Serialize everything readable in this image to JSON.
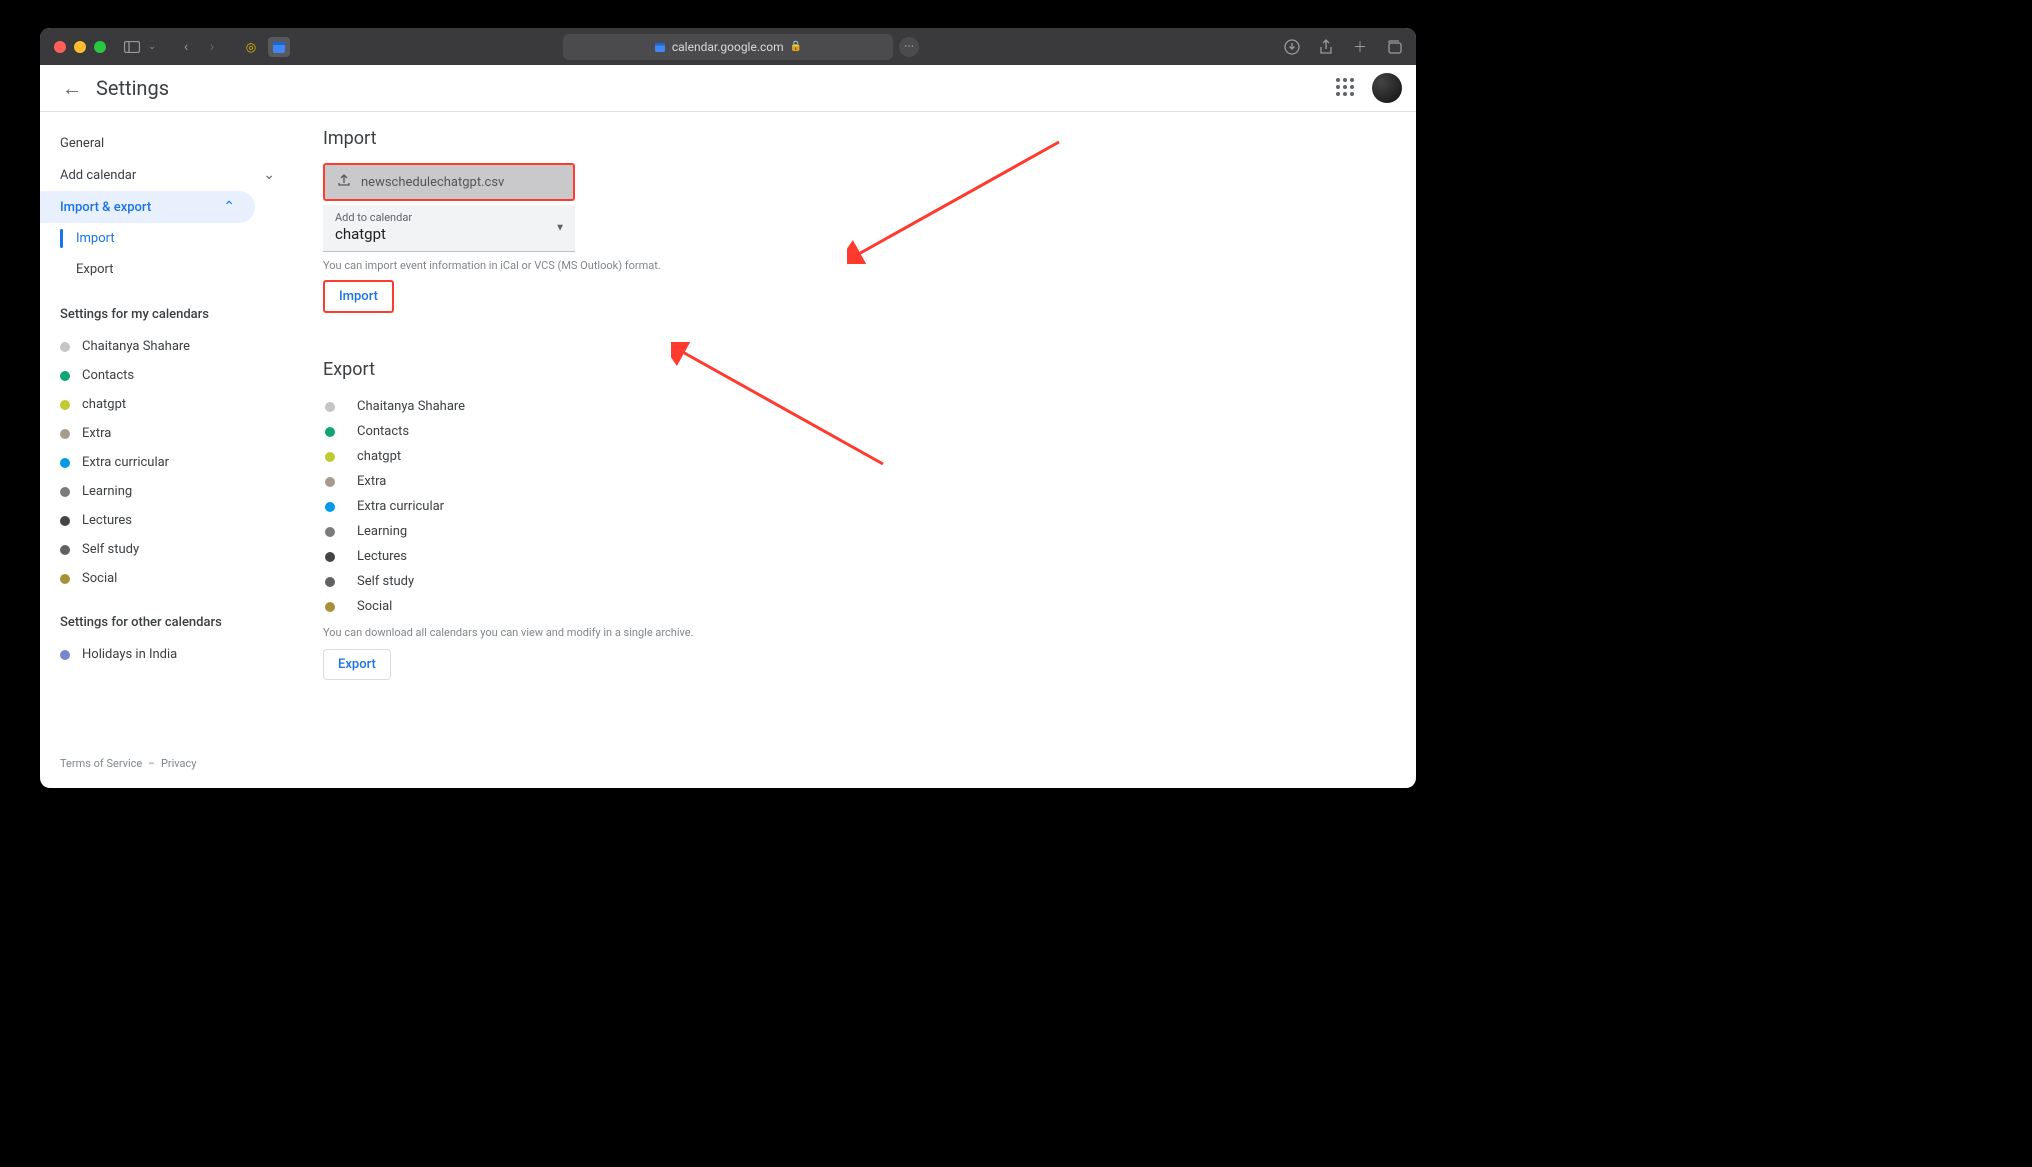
{
  "browser": {
    "url": "calendar.google.com"
  },
  "header": {
    "title": "Settings"
  },
  "sidebar": {
    "general": "General",
    "addCalendar": "Add calendar",
    "importExport": "Import & export",
    "import": "Import",
    "export": "Export",
    "myCalsHead": "Settings for my calendars",
    "otherCalsHead": "Settings for other calendars",
    "myCals": [
      {
        "label": "Chaitanya Shahare",
        "color": "#c5c5c5"
      },
      {
        "label": "Contacts",
        "color": "#0fa573"
      },
      {
        "label": "chatgpt",
        "color": "#c0ca33"
      },
      {
        "label": "Extra",
        "color": "#a79b8e"
      },
      {
        "label": "Extra curricular",
        "color": "#039be5"
      },
      {
        "label": "Learning",
        "color": "#7b7b7b"
      },
      {
        "label": "Lectures",
        "color": "#454545"
      },
      {
        "label": "Self study",
        "color": "#616161"
      },
      {
        "label": "Social",
        "color": "#a9913a"
      }
    ],
    "otherCals": [
      {
        "label": "Holidays in India",
        "color": "#7986cb"
      }
    ]
  },
  "import": {
    "title": "Import",
    "filename": "newschedulechatgpt.csv",
    "addToLabel": "Add to calendar",
    "selectedCalendar": "chatgpt",
    "hint": "You can import event information in iCal or VCS (MS Outlook) format.",
    "button": "Import"
  },
  "export": {
    "title": "Export",
    "cals": [
      {
        "label": "Chaitanya Shahare",
        "color": "#c5c5c5"
      },
      {
        "label": "Contacts",
        "color": "#0fa573"
      },
      {
        "label": "chatgpt",
        "color": "#c0ca33"
      },
      {
        "label": "Extra",
        "color": "#a79b8e"
      },
      {
        "label": "Extra curricular",
        "color": "#039be5"
      },
      {
        "label": "Learning",
        "color": "#7b7b7b"
      },
      {
        "label": "Lectures",
        "color": "#454545"
      },
      {
        "label": "Self study",
        "color": "#616161"
      },
      {
        "label": "Social",
        "color": "#a9913a"
      }
    ],
    "hint": "You can download all calendars you can view and modify in a single archive.",
    "button": "Export"
  },
  "footer": {
    "tos": "Terms of Service",
    "privacy": "Privacy"
  }
}
